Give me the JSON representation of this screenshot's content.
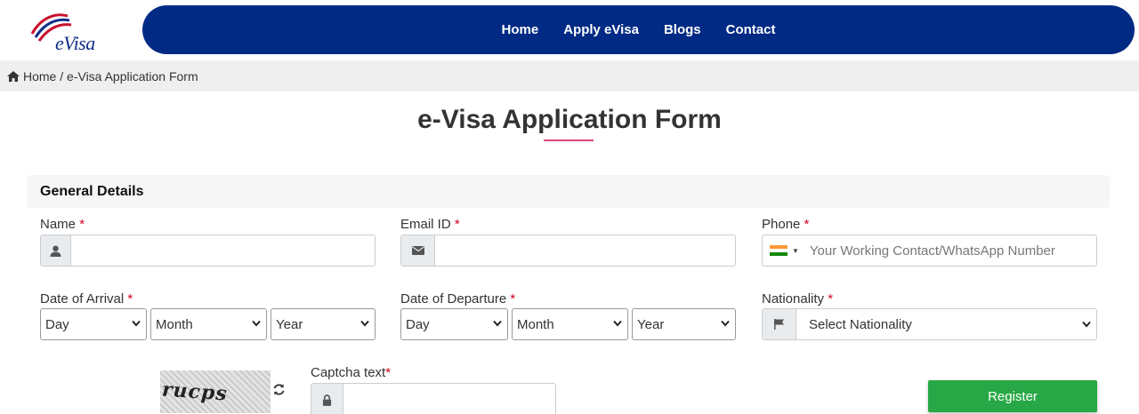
{
  "header": {
    "logo_text": "eVisa",
    "nav": [
      "Home",
      "Apply eVisa",
      "Blogs",
      "Contact"
    ]
  },
  "breadcrumb": {
    "home": "Home",
    "separator": " / ",
    "current": "e-Visa Application Form"
  },
  "page": {
    "title": "e-Visa Application Form"
  },
  "section": {
    "title": "General Details"
  },
  "fields": {
    "name_label": "Name",
    "email_label": "Email ID",
    "phone_label": "Phone",
    "phone_placeholder": "Your Working Contact/WhatsApp Number",
    "arrival_label": "Date of Arrival",
    "departure_label": "Date of Departure",
    "nationality_label": "Nationality",
    "nationality_value": "Select Nationality",
    "day": "Day",
    "month": "Month",
    "year": "Year",
    "required_mark": "*"
  },
  "captcha": {
    "image_text": "rucps",
    "label": "Captcha text"
  },
  "actions": {
    "register": "Register"
  },
  "colors": {
    "navbar": "#012a84",
    "register": "#27a745",
    "required": "#d0021b",
    "title_underline": "#e0457b"
  },
  "icons": {
    "home": "home-icon",
    "user": "user-icon",
    "email": "envelope-icon",
    "flag": "flag-icon",
    "lock": "lock-icon",
    "refresh": "refresh-icon"
  }
}
